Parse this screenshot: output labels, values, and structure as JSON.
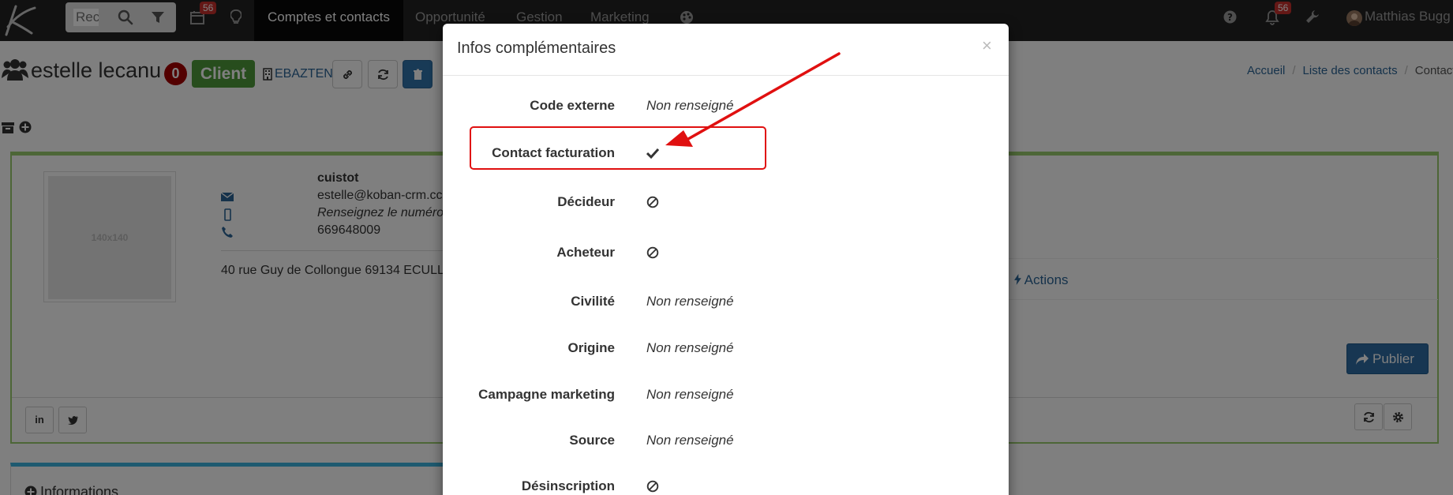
{
  "navbar": {
    "search_placeholder": "Rec",
    "calendar_badge": "56",
    "menu": {
      "accounts": "Comptes et contacts",
      "opportunity": "Opportunité",
      "management": "Gestion",
      "marketing": "Marketing"
    },
    "notif_badge": "56",
    "user_name": "Matthias Bugg"
  },
  "header": {
    "contact_name": "estelle lecanu",
    "count": "0",
    "status_label": "Client",
    "company_link": "EBAZTEN",
    "breadcrumb": [
      "Accueil",
      "Liste des contacts",
      "Contact"
    ]
  },
  "contact": {
    "placeholder": "140x140",
    "job_title": "cuistot",
    "email": "estelle@koban-crm.cc",
    "mobile_placeholder": "Renseignez le numéro",
    "phone": "669648009",
    "address": "40 rue Guy de Collongue 69134 ECULL",
    "actions_tab": "Actions",
    "publish_label": "Publier",
    "linkedin_label": "in",
    "info_panel_title": "Informations"
  },
  "modal": {
    "title": "Infos complémentaires",
    "close": "×",
    "fields": [
      {
        "label": "Code externe",
        "value": "Non renseigné"
      },
      {
        "label": "Contact facturation",
        "icon": "check-icon"
      },
      {
        "label": "Décideur",
        "icon": "ban-icon"
      },
      {
        "label": "Acheteur",
        "icon": "ban-icon"
      },
      {
        "label": "Civilité",
        "value": "Non renseigné"
      },
      {
        "label": "Origine",
        "value": "Non renseigné"
      },
      {
        "label": "Campagne marketing",
        "value": "Non renseigné"
      },
      {
        "label": "Source",
        "value": "Non renseigné"
      },
      {
        "label": "Désinscription",
        "icon": "ban-icon"
      }
    ]
  },
  "colors": {
    "navbar": "#222222",
    "client_green": "#4e9a3b",
    "count_red": "#a70000",
    "link_blue": "#2a6496",
    "annotation_red": "#e01010"
  }
}
